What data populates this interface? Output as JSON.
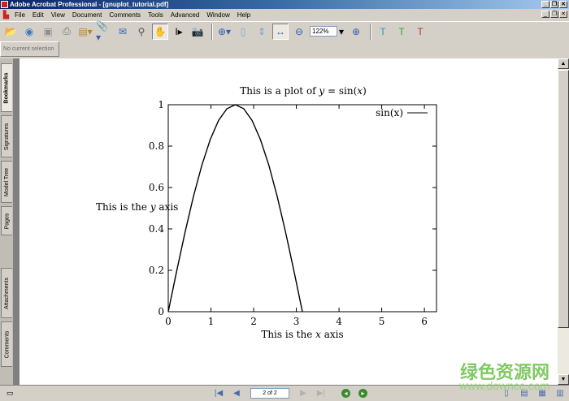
{
  "window": {
    "title": "Adobe Acrobat Professional - [gnuplot_tutorial.pdf]"
  },
  "menu": [
    "File",
    "Edit",
    "View",
    "Document",
    "Comments",
    "Tools",
    "Advanced",
    "Window",
    "Help"
  ],
  "toolbar": {
    "zoom_value": "122%"
  },
  "selection_status": "No current selection",
  "left_tabs": [
    "Bookmarks",
    "Signatures",
    "Model Tree",
    "Pages",
    "Attachments",
    "Comments"
  ],
  "statusbar": {
    "page_indicator": "2 of 2"
  },
  "watermark": {
    "cn": "绿色资源网",
    "url": "www.downcc.com"
  },
  "chart_data": {
    "type": "line",
    "title_prefix": "This is a plot of ",
    "title_var": "y",
    "title_suffix": " = sin(",
    "title_var2": "x",
    "title_end": ")",
    "xlabel_prefix": "This is the ",
    "xlabel_var": "x",
    "xlabel_suffix": " axis",
    "ylabel_prefix": "This is  the ",
    "ylabel_var": "y",
    "ylabel_suffix": " axis",
    "xlim": [
      0,
      6.2832
    ],
    "ylim": [
      0,
      1
    ],
    "xticks": [
      "0",
      "1",
      "2",
      "3",
      "4",
      "5",
      "6"
    ],
    "yticks": [
      "0",
      "0.2",
      "0.4",
      "0.6",
      "0.8",
      "1"
    ],
    "legend": {
      "label": "sin(x)",
      "placement": "top-right"
    },
    "series": [
      {
        "name": "sin(x)",
        "x": [
          0,
          0.1963,
          0.3927,
          0.589,
          0.7854,
          0.9817,
          1.1781,
          1.3744,
          1.5708,
          1.7671,
          1.9635,
          2.1598,
          2.3562,
          2.5525,
          2.7489,
          2.9452,
          3.1416
        ],
        "y": [
          0,
          0.1951,
          0.3827,
          0.5556,
          0.7071,
          0.8315,
          0.9239,
          0.9808,
          1,
          0.9808,
          0.9239,
          0.8315,
          0.7071,
          0.5556,
          0.3827,
          0.1951,
          0
        ]
      }
    ]
  }
}
